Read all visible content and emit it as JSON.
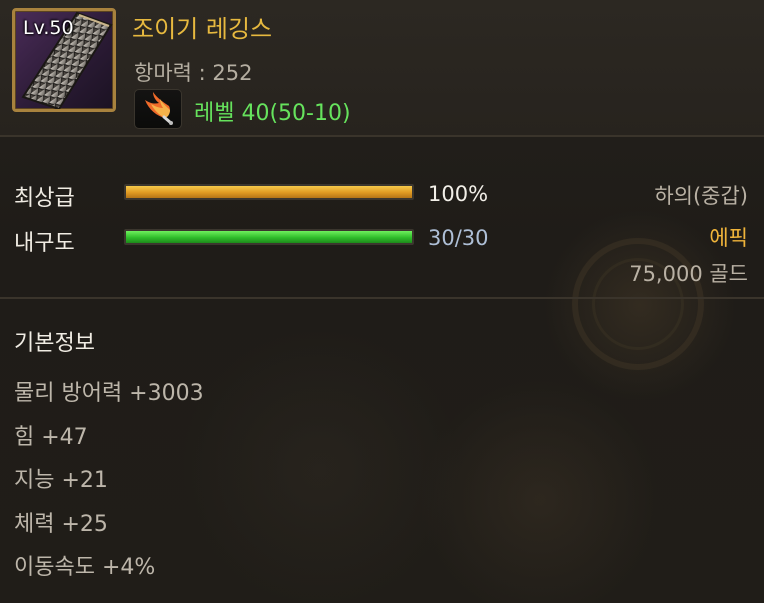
{
  "item": {
    "level_badge": "Lv.50",
    "name": "조이기 레깅스",
    "stat_line": "항마력 : 252",
    "requirement_icon": "phoenix-feather-icon",
    "requirement_text": "레벨 40(50-10)"
  },
  "grade": {
    "label": "최상급",
    "value_text": "100%",
    "fill_fraction": 1.0,
    "color": "#e9a92a"
  },
  "durability": {
    "label": "내구도",
    "value_text": "30/30",
    "fill_fraction": 1.0,
    "color": "#36c42f"
  },
  "info": {
    "slot": "하의(중갑)",
    "rarity": "에픽",
    "rarity_color": "#f0b43a",
    "price": "75,000 골드"
  },
  "basic_info": {
    "title": "기본정보",
    "lines": [
      "물리 방어력 +3003",
      "힘 +47",
      "지능 +21",
      "체력 +25",
      "이동속도 +4%"
    ]
  }
}
